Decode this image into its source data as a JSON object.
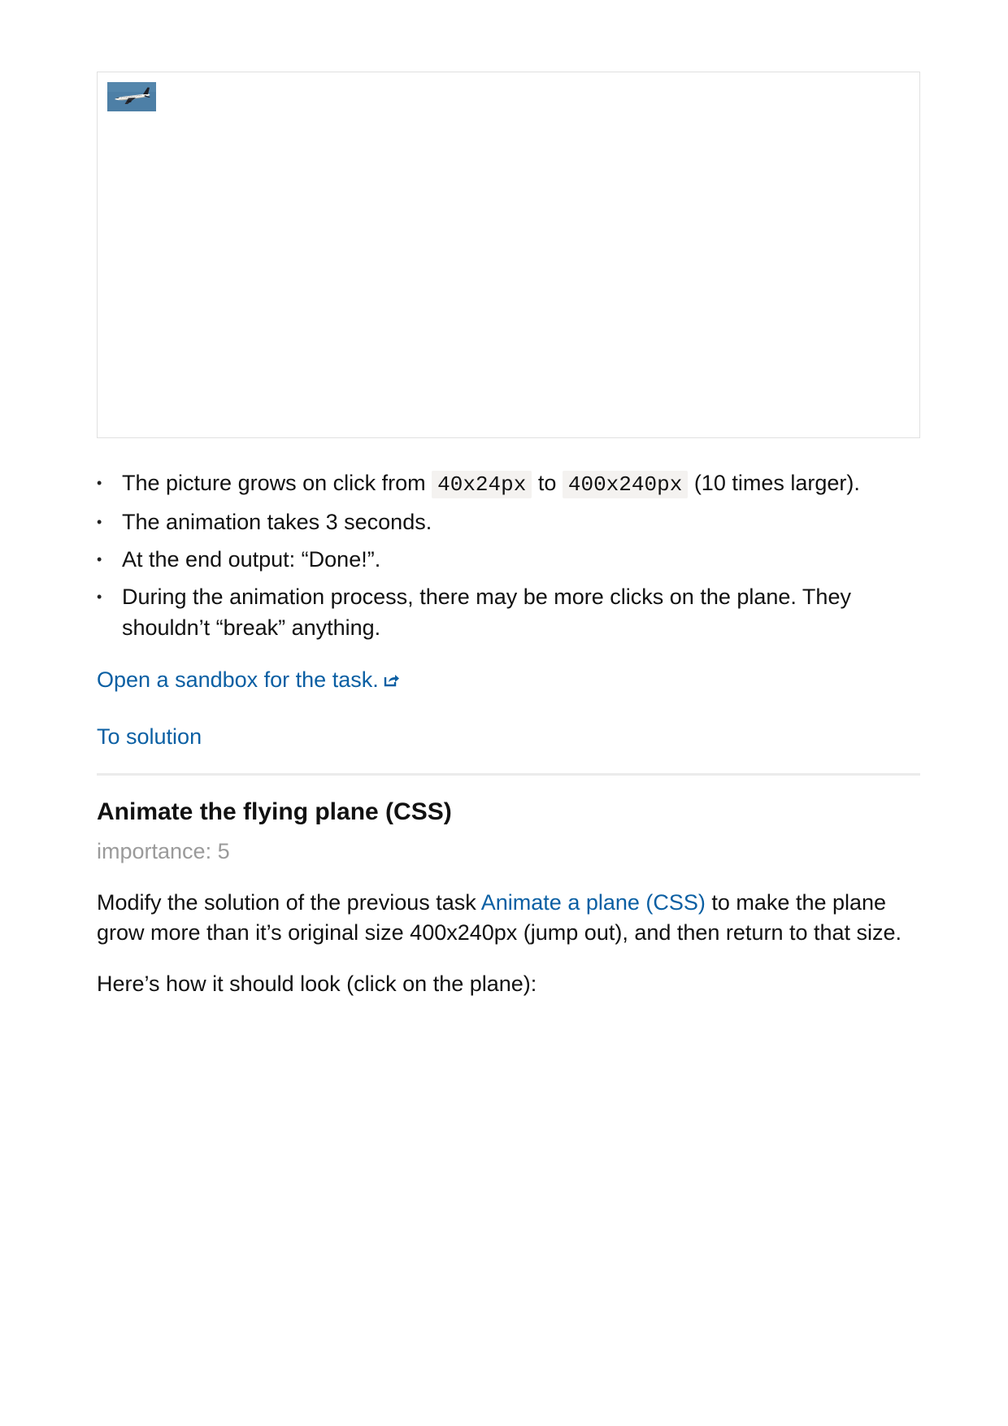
{
  "demo": {
    "plane_image_alt": "plane",
    "colors": {
      "sky": "#4d7fa6",
      "frame_border": "#e0e0e0"
    }
  },
  "list": {
    "item1": {
      "before": "The picture grows on click from ",
      "code1": "40x24px",
      "middle": " to ",
      "code2": "400x240px",
      "after": " (10 times larger)."
    },
    "item2": "The animation takes 3 seconds.",
    "item3": "At the end output: “Done!”.",
    "item4": "During the animation process, there may be more clicks on the plane. They shouldn’t “break” anything."
  },
  "links": {
    "sandbox": "Open a sandbox for the task.",
    "sandbox_icon": "external-link-icon",
    "to_solution": "To solution"
  },
  "task2": {
    "title": "Animate the flying plane (CSS)",
    "importance": "importance: 5",
    "para1": {
      "before": "Modify the solution of the previous task ",
      "link": "Animate a plane (CSS)",
      "after": " to make the plane grow more than it’s original size 400x240px (jump out), and then return to that size."
    },
    "para2": "Here’s how it should look (click on the plane):"
  },
  "colors": {
    "link": "#0a5fa3",
    "muted": "#9a9a9a",
    "code_bg": "#f4f2f0",
    "divider": "#ebebeb"
  }
}
